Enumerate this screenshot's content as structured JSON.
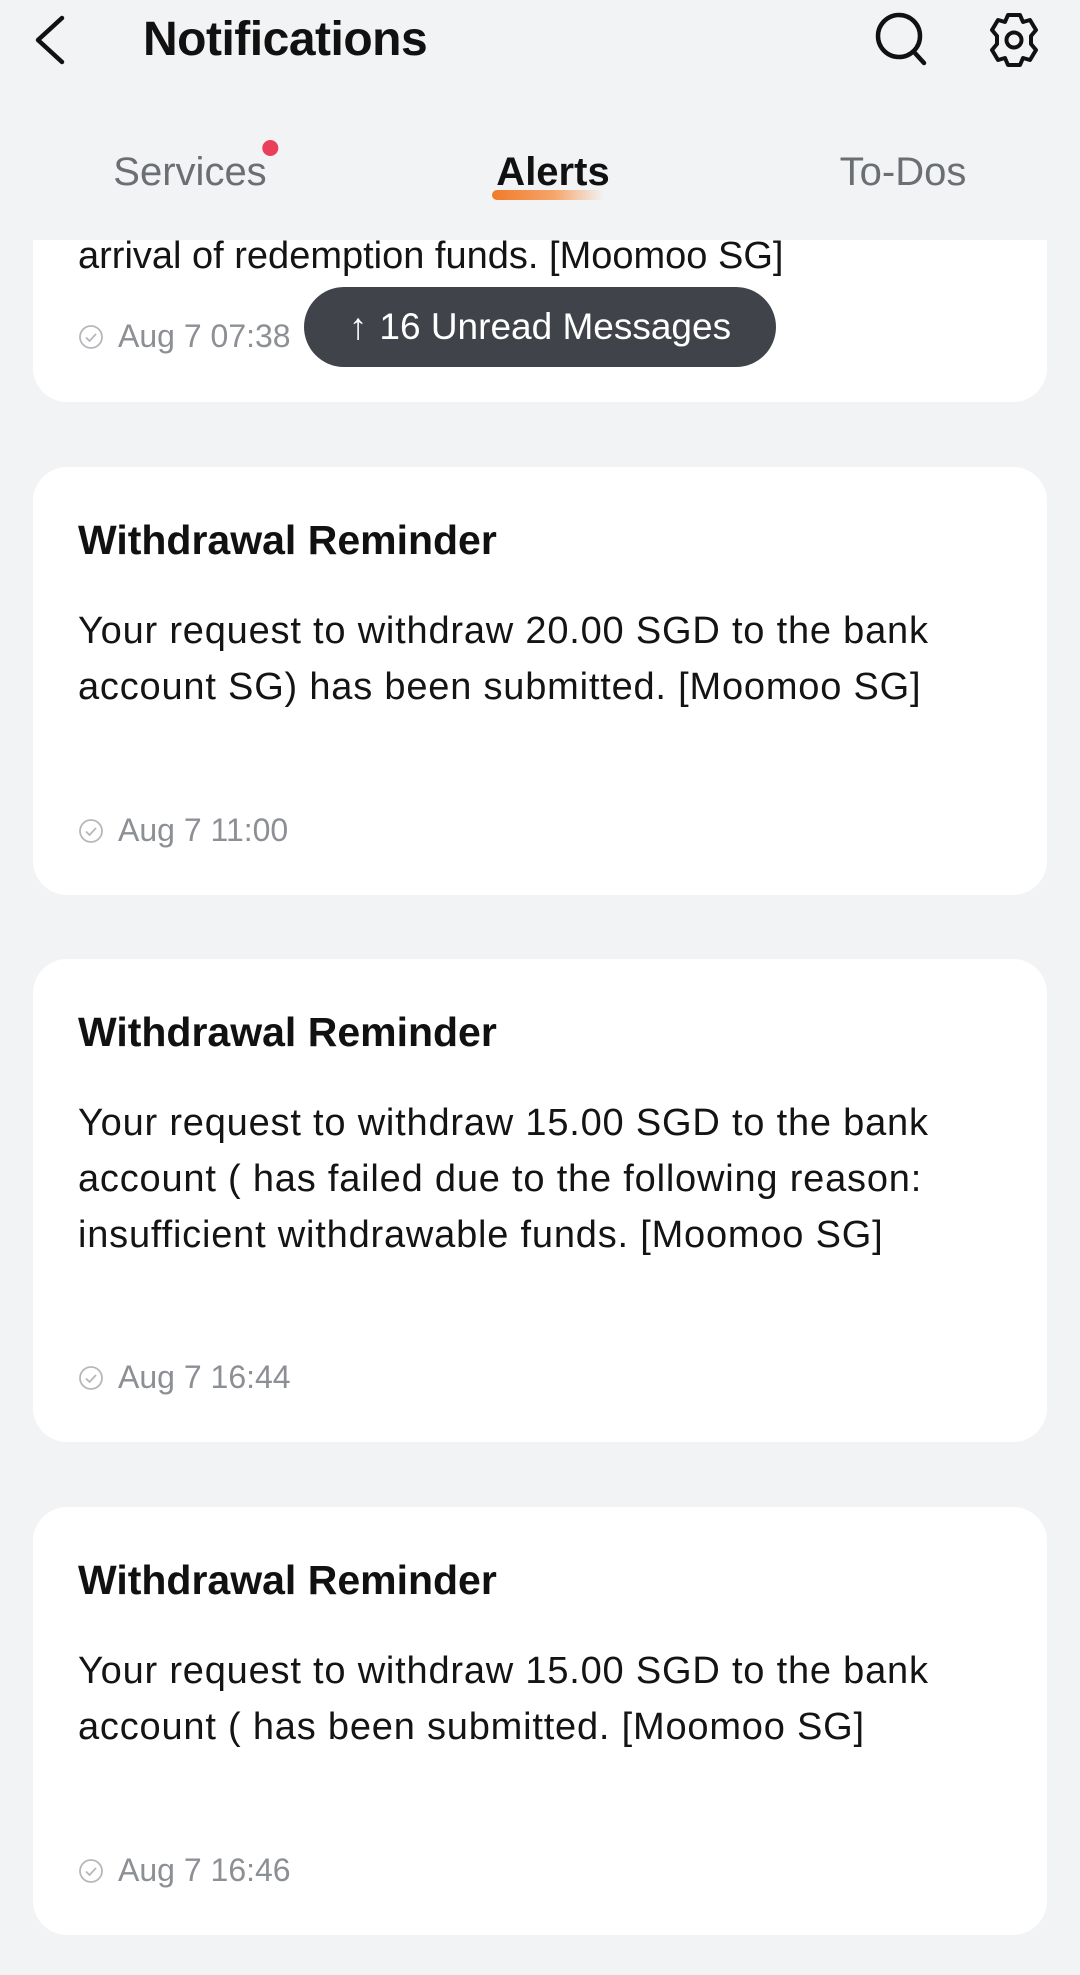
{
  "header": {
    "title": "Notifications",
    "back_icon": "chevron-left-icon",
    "search_icon": "search-icon",
    "settings_icon": "gear-icon"
  },
  "tabs": [
    {
      "label": "Services",
      "has_badge": true,
      "active": false
    },
    {
      "label": "Alerts",
      "has_badge": false,
      "active": true
    },
    {
      "label": "To-Dos",
      "has_badge": false,
      "active": false
    }
  ],
  "colors": {
    "accent": "#f07a28",
    "badge": "#ea3f58",
    "background": "#f2f3f5",
    "pill": "#40434a"
  },
  "unread_pill": {
    "arrow": "↑",
    "label": "16 Unread Messages"
  },
  "notifications": [
    {
      "title": "",
      "body": "arrival of redemption funds. [Moomoo SG]",
      "time": "Aug 7 07:38"
    },
    {
      "title": "Withdrawal Reminder",
      "body": "Your request to withdraw 20.00 SGD to the bank account SG) has been submitted. [Moomoo SG]",
      "time": "Aug 7 11:00"
    },
    {
      "title": "Withdrawal Reminder",
      "body": "Your request to withdraw 15.00 SGD to the bank account ( has failed due to the following reason: insufficient withdrawable funds. [Moomoo SG]",
      "time": "Aug 7 16:44"
    },
    {
      "title": "Withdrawal Reminder",
      "body": "Your request to withdraw 15.00 SGD to the bank account ( has been submitted. [Moomoo SG]",
      "time": "Aug 7 16:46"
    }
  ]
}
